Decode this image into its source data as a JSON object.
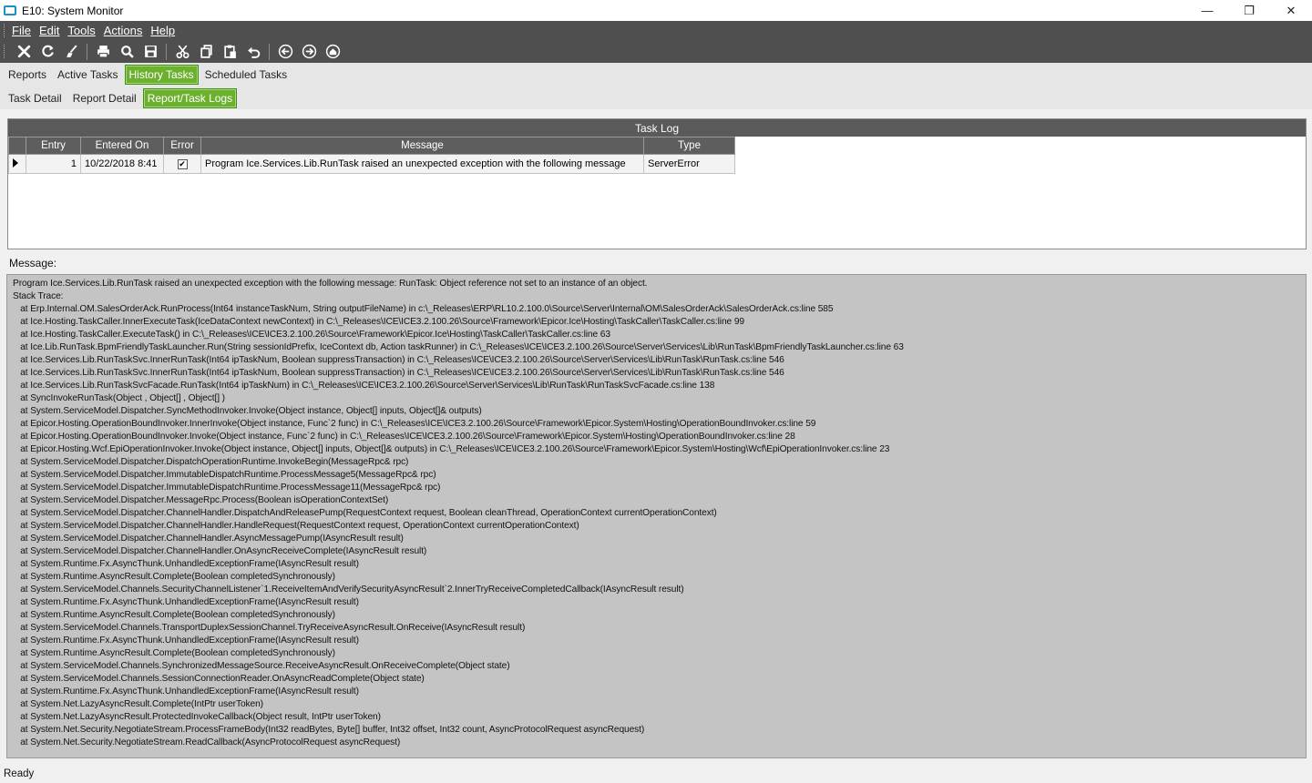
{
  "window": {
    "title": "E10: System Monitor",
    "min_label": "—",
    "restore_label": "❐",
    "close_label": "✕"
  },
  "menu": [
    "File",
    "Edit",
    "Tools",
    "Actions",
    "Help"
  ],
  "toolbar": {
    "icons": [
      "close-icon",
      "refresh-icon",
      "clear-icon",
      "print-icon",
      "print-preview-icon",
      "save-icon",
      "cut-icon",
      "copy-icon",
      "paste-icon",
      "undo-icon",
      "back-icon",
      "forward-icon",
      "home-icon"
    ]
  },
  "tabs_primary": [
    {
      "label": "Reports",
      "active": false
    },
    {
      "label": "Active Tasks",
      "active": false
    },
    {
      "label": "History Tasks",
      "active": true
    },
    {
      "label": "Scheduled Tasks",
      "active": false
    }
  ],
  "tabs_secondary": [
    {
      "label": "Task Detail",
      "active": false
    },
    {
      "label": "Report Detail",
      "active": false
    },
    {
      "label": "Report/Task Logs",
      "active": true
    }
  ],
  "task_log": {
    "title": "Task Log",
    "columns": [
      "Entry",
      "Entered On",
      "Error",
      "Message",
      "Type"
    ],
    "rows": [
      {
        "entry": "1",
        "entered_on": "10/22/2018 8:41",
        "error": true,
        "message": "Program Ice.Services.Lib.RunTask raised an unexpected exception with the following message",
        "type": "ServerError"
      }
    ]
  },
  "message": {
    "label": "Message:",
    "lines": [
      "Program Ice.Services.Lib.RunTask raised an unexpected exception with the following message: RunTask: Object reference not set to an instance of an object.",
      "Stack Trace:",
      "   at Erp.Internal.OM.SalesOrderAck.RunProcess(Int64 instanceTaskNum, String outputFileName) in c:\\_Releases\\ERP\\RL10.2.100.0\\Source\\Server\\Internal\\OM\\SalesOrderAck\\SalesOrderAck.cs:line 585",
      "   at Ice.Hosting.TaskCaller.InnerExecuteTask(IceDataContext newContext) in C:\\_Releases\\ICE\\ICE3.2.100.26\\Source\\Framework\\Epicor.Ice\\Hosting\\TaskCaller\\TaskCaller.cs:line 99",
      "   at Ice.Hosting.TaskCaller.ExecuteTask() in C:\\_Releases\\ICE\\ICE3.2.100.26\\Source\\Framework\\Epicor.Ice\\Hosting\\TaskCaller\\TaskCaller.cs:line 63",
      "   at Ice.Lib.RunTask.BpmFriendlyTaskLauncher.Run(String sessionIdPrefix, IceContext db, Action taskRunner) in C:\\_Releases\\ICE\\ICE3.2.100.26\\Source\\Server\\Services\\Lib\\RunTask\\BpmFriendlyTaskLauncher.cs:line 63",
      "   at Ice.Services.Lib.RunTaskSvc.InnerRunTask(Int64 ipTaskNum, Boolean suppressTransaction) in C:\\_Releases\\ICE\\ICE3.2.100.26\\Source\\Server\\Services\\Lib\\RunTask\\RunTask.cs:line 546",
      "   at Ice.Services.Lib.RunTaskSvc.InnerRunTask(Int64 ipTaskNum, Boolean suppressTransaction) in C:\\_Releases\\ICE\\ICE3.2.100.26\\Source\\Server\\Services\\Lib\\RunTask\\RunTask.cs:line 546",
      "   at Ice.Services.Lib.RunTaskSvcFacade.RunTask(Int64 ipTaskNum) in C:\\_Releases\\ICE\\ICE3.2.100.26\\Source\\Server\\Services\\Lib\\RunTask\\RunTaskSvcFacade.cs:line 138",
      "   at SyncInvokeRunTask(Object , Object[] , Object[] )",
      "   at System.ServiceModel.Dispatcher.SyncMethodInvoker.Invoke(Object instance, Object[] inputs, Object[]& outputs)",
      "   at Epicor.Hosting.OperationBoundInvoker.InnerInvoke(Object instance, Func`2 func) in C:\\_Releases\\ICE\\ICE3.2.100.26\\Source\\Framework\\Epicor.System\\Hosting\\OperationBoundInvoker.cs:line 59",
      "   at Epicor.Hosting.OperationBoundInvoker.Invoke(Object instance, Func`2 func) in C:\\_Releases\\ICE\\ICE3.2.100.26\\Source\\Framework\\Epicor.System\\Hosting\\OperationBoundInvoker.cs:line 28",
      "   at Epicor.Hosting.Wcf.EpiOperationInvoker.Invoke(Object instance, Object[] inputs, Object[]& outputs) in C:\\_Releases\\ICE\\ICE3.2.100.26\\Source\\Framework\\Epicor.System\\Hosting\\Wcf\\EpiOperationInvoker.cs:line 23",
      "   at System.ServiceModel.Dispatcher.DispatchOperationRuntime.InvokeBegin(MessageRpc& rpc)",
      "   at System.ServiceModel.Dispatcher.ImmutableDispatchRuntime.ProcessMessage5(MessageRpc& rpc)",
      "   at System.ServiceModel.Dispatcher.ImmutableDispatchRuntime.ProcessMessage11(MessageRpc& rpc)",
      "   at System.ServiceModel.Dispatcher.MessageRpc.Process(Boolean isOperationContextSet)",
      "   at System.ServiceModel.Dispatcher.ChannelHandler.DispatchAndReleasePump(RequestContext request, Boolean cleanThread, OperationContext currentOperationContext)",
      "   at System.ServiceModel.Dispatcher.ChannelHandler.HandleRequest(RequestContext request, OperationContext currentOperationContext)",
      "   at System.ServiceModel.Dispatcher.ChannelHandler.AsyncMessagePump(IAsyncResult result)",
      "   at System.ServiceModel.Dispatcher.ChannelHandler.OnAsyncReceiveComplete(IAsyncResult result)",
      "   at System.Runtime.Fx.AsyncThunk.UnhandledExceptionFrame(IAsyncResult result)",
      "   at System.Runtime.AsyncResult.Complete(Boolean completedSynchronously)",
      "   at System.ServiceModel.Channels.SecurityChannelListener`1.ReceiveItemAndVerifySecurityAsyncResult`2.InnerTryReceiveCompletedCallback(IAsyncResult result)",
      "   at System.Runtime.Fx.AsyncThunk.UnhandledExceptionFrame(IAsyncResult result)",
      "   at System.Runtime.AsyncResult.Complete(Boolean completedSynchronously)",
      "   at System.ServiceModel.Channels.TransportDuplexSessionChannel.TryReceiveAsyncResult.OnReceive(IAsyncResult result)",
      "   at System.Runtime.Fx.AsyncThunk.UnhandledExceptionFrame(IAsyncResult result)",
      "   at System.Runtime.AsyncResult.Complete(Boolean completedSynchronously)",
      "   at System.ServiceModel.Channels.SynchronizedMessageSource.ReceiveAsyncResult.OnReceiveComplete(Object state)",
      "   at System.ServiceModel.Channels.SessionConnectionReader.OnAsyncReadComplete(Object state)",
      "   at System.Runtime.Fx.AsyncThunk.UnhandledExceptionFrame(IAsyncResult result)",
      "   at System.Net.LazyAsyncResult.Complete(IntPtr userToken)",
      "   at System.Net.LazyAsyncResult.ProtectedInvokeCallback(Object result, IntPtr userToken)",
      "   at System.Net.Security.NegotiateStream.ProcessFrameBody(Int32 readBytes, Byte[] buffer, Int32 offset, Int32 count, AsyncProtocolRequest asyncRequest)",
      "   at System.Net.Security.NegotiateStream.ReadCallback(AsyncProtocolRequest asyncRequest)"
    ]
  },
  "status": {
    "text": "Ready"
  },
  "colors": {
    "accent_green": "#6cb12e",
    "toolbar_dark": "#4f4f4f",
    "message_bg": "#c4c4c4"
  }
}
